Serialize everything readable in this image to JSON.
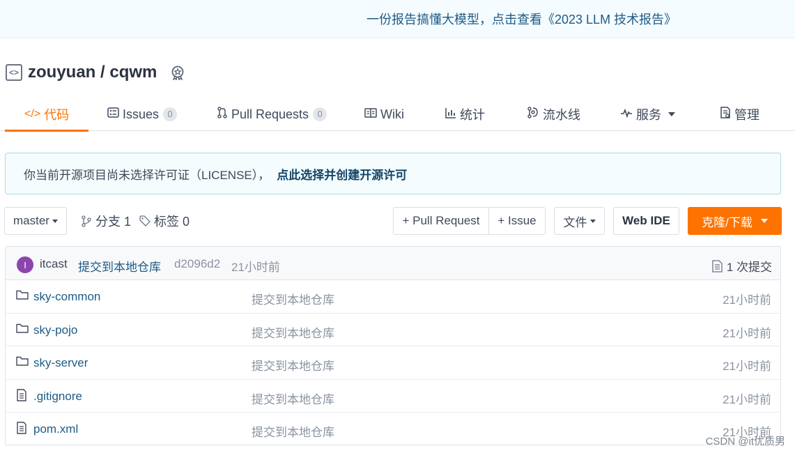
{
  "banner": {
    "text": "一份报告搞懂大模型，点击查看《2023 LLM 技术报告》"
  },
  "repo": {
    "name": "zouyuan / cqwm"
  },
  "tabs": [
    {
      "label": "代码",
      "icon": "code-icon"
    },
    {
      "label": "Issues",
      "count": "0",
      "icon": "issues-icon"
    },
    {
      "label": "Pull Requests",
      "count": "0",
      "icon": "pull-request-icon"
    },
    {
      "label": "Wiki",
      "icon": "book-icon"
    },
    {
      "label": "统计",
      "icon": "chart-icon"
    },
    {
      "label": "流水线",
      "icon": "pipeline-icon"
    },
    {
      "label": "服务",
      "icon": "pulse-icon"
    },
    {
      "label": "管理",
      "icon": "manage-icon"
    }
  ],
  "license": {
    "text": "你当前开源项目尚未选择许可证（LICENSE），",
    "link": "点此选择并创建开源许可"
  },
  "toolbar": {
    "branch": "master",
    "branches": "分支 1",
    "tags": "标签 0",
    "pull_request": "+ Pull Request",
    "issue": "+ Issue",
    "files": "文件",
    "web_ide": "Web IDE",
    "clone": "克隆/下载"
  },
  "commit": {
    "avatar_letter": "I",
    "author": "itcast",
    "message": "提交到本地仓库",
    "hash": "d2096d2",
    "time": "21小时前",
    "count": "1 次提交"
  },
  "files": [
    {
      "name": "sky-common",
      "type": "folder",
      "message": "提交到本地仓库",
      "time": "21小时前"
    },
    {
      "name": "sky-pojo",
      "type": "folder",
      "message": "提交到本地仓库",
      "time": "21小时前"
    },
    {
      "name": "sky-server",
      "type": "folder",
      "message": "提交到本地仓库",
      "time": "21小时前"
    },
    {
      "name": ".gitignore",
      "type": "file",
      "message": "提交到本地仓库",
      "time": "21小时前"
    },
    {
      "name": "pom.xml",
      "type": "file",
      "message": "提交到本地仓库",
      "time": "21小时前"
    }
  ],
  "watermark": "CSDN @it优质男",
  "colors": {
    "accent": "#fe7300",
    "link": "#1d5a86"
  }
}
